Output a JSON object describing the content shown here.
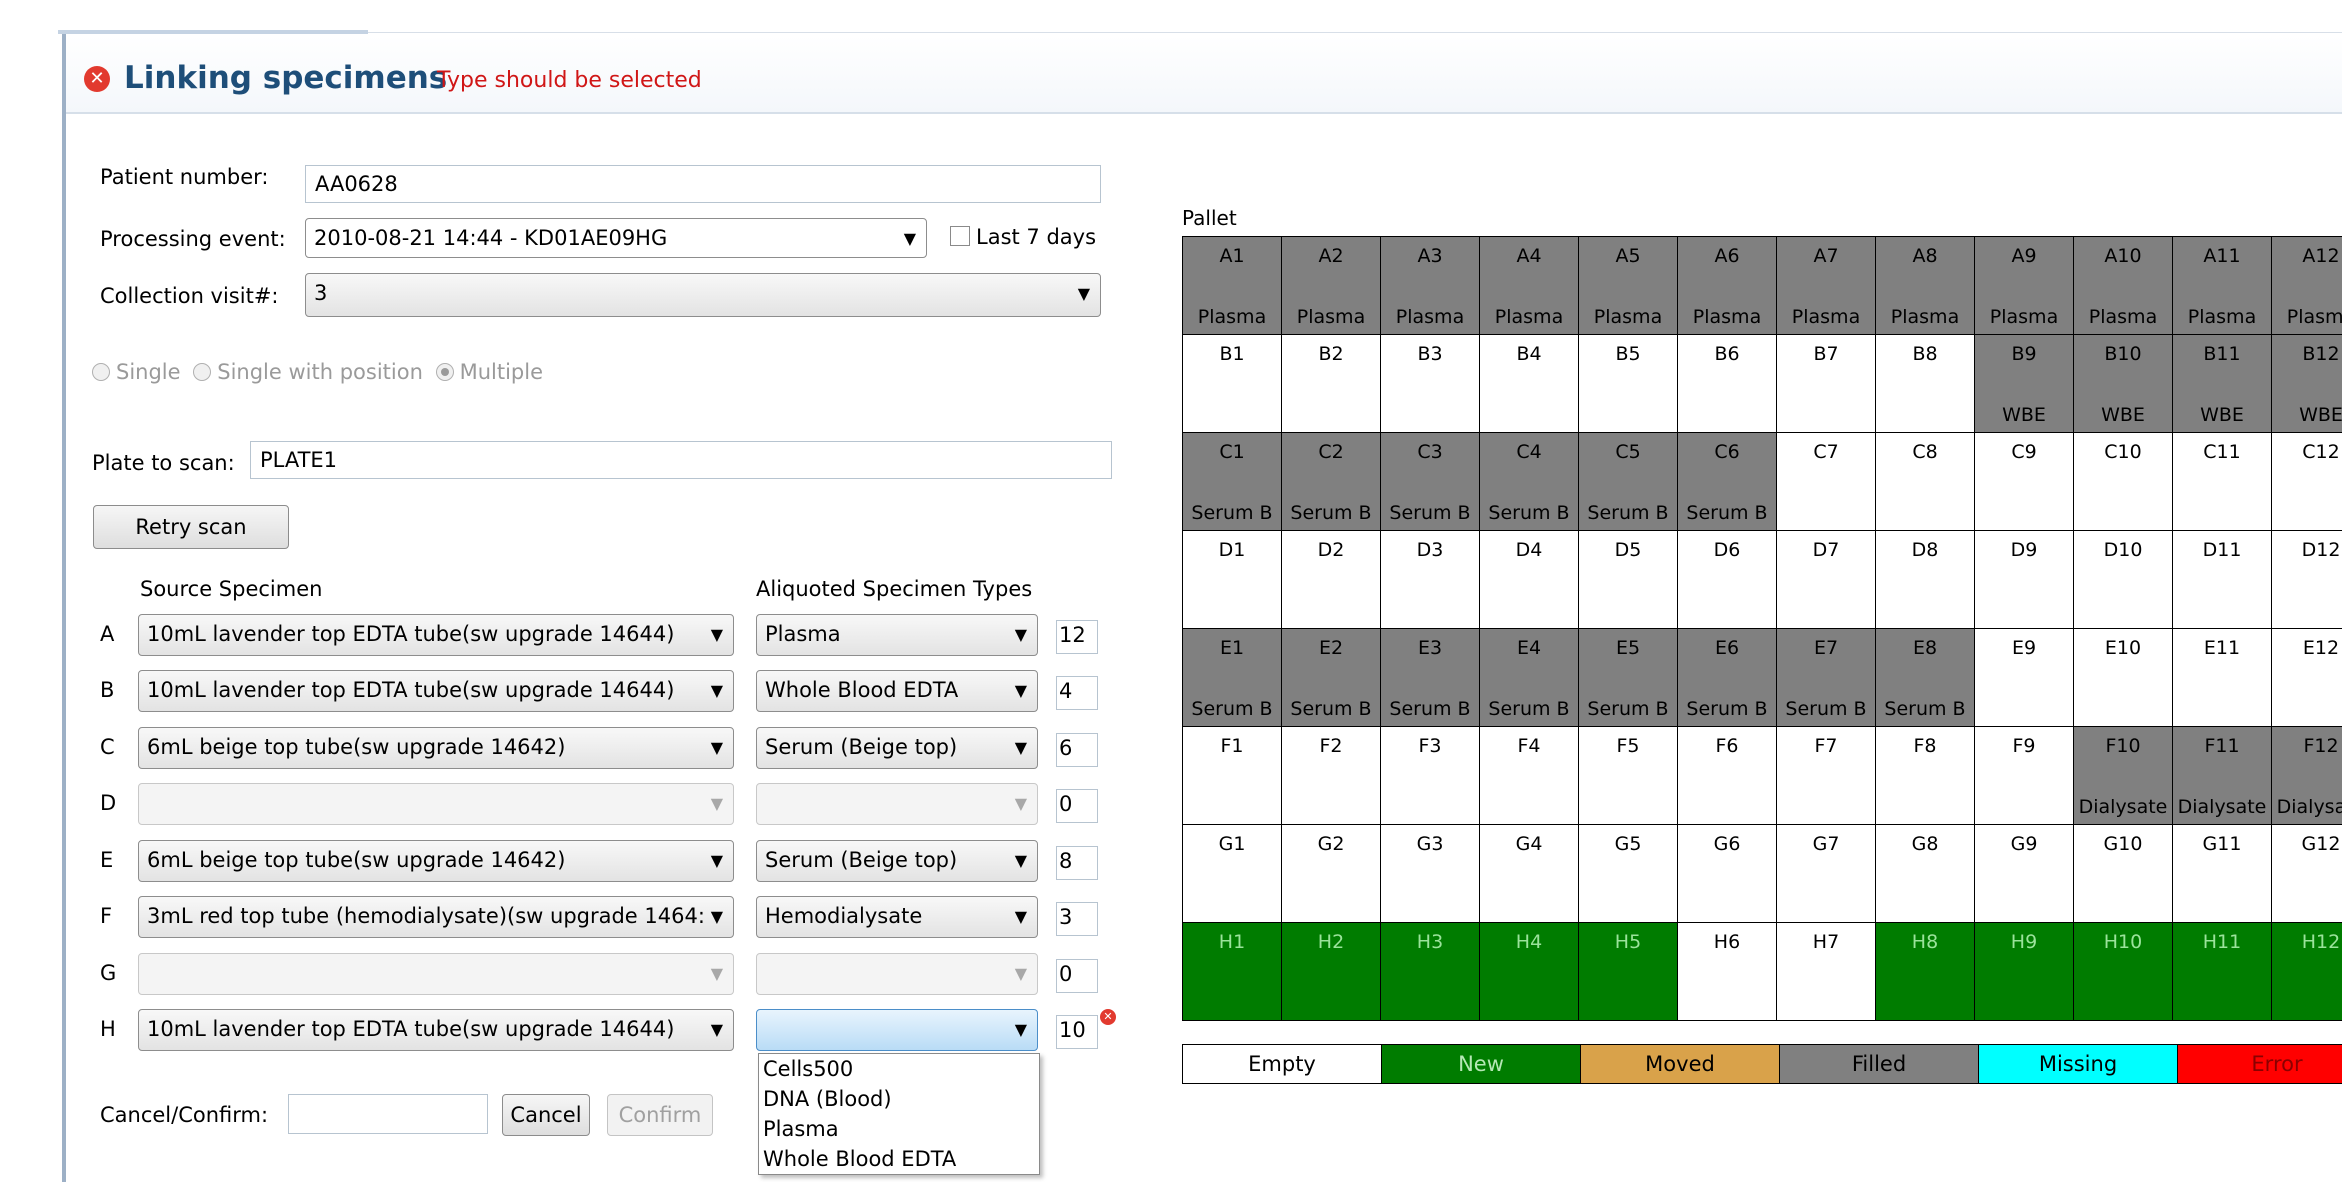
{
  "header": {
    "title": "Linking specimens",
    "error_message": "Type should be selected"
  },
  "form": {
    "patient_label": "Patient number:",
    "patient_value": "AA0628",
    "event_label": "Processing event:",
    "event_value": "2010-08-21 14:44 - KD01AE09HG",
    "last7_label": "Last 7 days",
    "visit_label": "Collection visit#:",
    "visit_value": "3",
    "mode_options": [
      "Single",
      "Single with position",
      "Multiple"
    ],
    "mode_selected": "Multiple",
    "plate_label": "Plate to scan:",
    "plate_value": "PLATE1",
    "retry_label": "Retry scan",
    "source_header": "Source Specimen",
    "types_header": "Aliquoted Specimen Types",
    "rows": [
      {
        "letter": "A",
        "source": "10mL lavender top EDTA tube(sw upgrade 14644)",
        "type": "Plasma",
        "qty": "12"
      },
      {
        "letter": "B",
        "source": "10mL lavender top EDTA tube(sw upgrade 14644)",
        "type": "Whole Blood EDTA",
        "qty": "4"
      },
      {
        "letter": "C",
        "source": "6mL beige top tube(sw upgrade 14642)",
        "type": "Serum (Beige top)",
        "qty": "6"
      },
      {
        "letter": "D",
        "source": "",
        "type": "",
        "qty": "0"
      },
      {
        "letter": "E",
        "source": "6mL beige top tube(sw upgrade 14642)",
        "type": "Serum (Beige top)",
        "qty": "8"
      },
      {
        "letter": "F",
        "source": "3mL red top tube (hemodialysate)(sw upgrade 1464:",
        "type": "Hemodialysate",
        "qty": "3"
      },
      {
        "letter": "G",
        "source": "",
        "type": "",
        "qty": "0"
      },
      {
        "letter": "H",
        "source": "10mL lavender top EDTA tube(sw upgrade 14644)",
        "type": "",
        "qty": "10"
      }
    ],
    "dropdown_options": [
      "Cells500",
      "DNA (Blood)",
      "Plasma",
      "Whole Blood EDTA"
    ],
    "confirm_label": "Cancel/Confirm:",
    "confirm_value": "",
    "cancel_button": "Cancel",
    "confirm_button": "Confirm"
  },
  "pallet": {
    "title": "Pallet",
    "colors": {
      "Filled": "#808080",
      "New": "#007c00",
      "Empty": "#ffffff"
    },
    "rows": [
      {
        "cells": [
          {
            "label": "A1",
            "type": "Plasma",
            "status": "Filled"
          },
          {
            "label": "A2",
            "type": "Plasma",
            "status": "Filled"
          },
          {
            "label": "A3",
            "type": "Plasma",
            "status": "Filled"
          },
          {
            "label": "A4",
            "type": "Plasma",
            "status": "Filled"
          },
          {
            "label": "A5",
            "type": "Plasma",
            "status": "Filled"
          },
          {
            "label": "A6",
            "type": "Plasma",
            "status": "Filled"
          },
          {
            "label": "A7",
            "type": "Plasma",
            "status": "Filled"
          },
          {
            "label": "A8",
            "type": "Plasma",
            "status": "Filled"
          },
          {
            "label": "A9",
            "type": "Plasma",
            "status": "Filled"
          },
          {
            "label": "A10",
            "type": "Plasma",
            "status": "Filled"
          },
          {
            "label": "A11",
            "type": "Plasma",
            "status": "Filled"
          },
          {
            "label": "A12",
            "type": "Plasma",
            "status": "Filled"
          }
        ]
      },
      {
        "cells": [
          {
            "label": "B1",
            "type": "",
            "status": "Empty"
          },
          {
            "label": "B2",
            "type": "",
            "status": "Empty"
          },
          {
            "label": "B3",
            "type": "",
            "status": "Empty"
          },
          {
            "label": "B4",
            "type": "",
            "status": "Empty"
          },
          {
            "label": "B5",
            "type": "",
            "status": "Empty"
          },
          {
            "label": "B6",
            "type": "",
            "status": "Empty"
          },
          {
            "label": "B7",
            "type": "",
            "status": "Empty"
          },
          {
            "label": "B8",
            "type": "",
            "status": "Empty"
          },
          {
            "label": "B9",
            "type": "WBE",
            "status": "Filled"
          },
          {
            "label": "B10",
            "type": "WBE",
            "status": "Filled"
          },
          {
            "label": "B11",
            "type": "WBE",
            "status": "Filled"
          },
          {
            "label": "B12",
            "type": "WBE",
            "status": "Filled"
          }
        ]
      },
      {
        "cells": [
          {
            "label": "C1",
            "type": "Serum B",
            "status": "Filled"
          },
          {
            "label": "C2",
            "type": "Serum B",
            "status": "Filled"
          },
          {
            "label": "C3",
            "type": "Serum B",
            "status": "Filled"
          },
          {
            "label": "C4",
            "type": "Serum B",
            "status": "Filled"
          },
          {
            "label": "C5",
            "type": "Serum B",
            "status": "Filled"
          },
          {
            "label": "C6",
            "type": "Serum B",
            "status": "Filled"
          },
          {
            "label": "C7",
            "type": "",
            "status": "Empty"
          },
          {
            "label": "C8",
            "type": "",
            "status": "Empty"
          },
          {
            "label": "C9",
            "type": "",
            "status": "Empty"
          },
          {
            "label": "C10",
            "type": "",
            "status": "Empty"
          },
          {
            "label": "C11",
            "type": "",
            "status": "Empty"
          },
          {
            "label": "C12",
            "type": "",
            "status": "Empty"
          }
        ]
      },
      {
        "cells": [
          {
            "label": "D1",
            "type": "",
            "status": "Empty"
          },
          {
            "label": "D2",
            "type": "",
            "status": "Empty"
          },
          {
            "label": "D3",
            "type": "",
            "status": "Empty"
          },
          {
            "label": "D4",
            "type": "",
            "status": "Empty"
          },
          {
            "label": "D5",
            "type": "",
            "status": "Empty"
          },
          {
            "label": "D6",
            "type": "",
            "status": "Empty"
          },
          {
            "label": "D7",
            "type": "",
            "status": "Empty"
          },
          {
            "label": "D8",
            "type": "",
            "status": "Empty"
          },
          {
            "label": "D9",
            "type": "",
            "status": "Empty"
          },
          {
            "label": "D10",
            "type": "",
            "status": "Empty"
          },
          {
            "label": "D11",
            "type": "",
            "status": "Empty"
          },
          {
            "label": "D12",
            "type": "",
            "status": "Empty"
          }
        ]
      },
      {
        "cells": [
          {
            "label": "E1",
            "type": "Serum B",
            "status": "Filled"
          },
          {
            "label": "E2",
            "type": "Serum B",
            "status": "Filled"
          },
          {
            "label": "E3",
            "type": "Serum B",
            "status": "Filled"
          },
          {
            "label": "E4",
            "type": "Serum B",
            "status": "Filled"
          },
          {
            "label": "E5",
            "type": "Serum B",
            "status": "Filled"
          },
          {
            "label": "E6",
            "type": "Serum B",
            "status": "Filled"
          },
          {
            "label": "E7",
            "type": "Serum B",
            "status": "Filled"
          },
          {
            "label": "E8",
            "type": "Serum B",
            "status": "Filled"
          },
          {
            "label": "E9",
            "type": "",
            "status": "Empty"
          },
          {
            "label": "E10",
            "type": "",
            "status": "Empty"
          },
          {
            "label": "E11",
            "type": "",
            "status": "Empty"
          },
          {
            "label": "E12",
            "type": "",
            "status": "Empty"
          }
        ]
      },
      {
        "cells": [
          {
            "label": "F1",
            "type": "",
            "status": "Empty"
          },
          {
            "label": "F2",
            "type": "",
            "status": "Empty"
          },
          {
            "label": "F3",
            "type": "",
            "status": "Empty"
          },
          {
            "label": "F4",
            "type": "",
            "status": "Empty"
          },
          {
            "label": "F5",
            "type": "",
            "status": "Empty"
          },
          {
            "label": "F6",
            "type": "",
            "status": "Empty"
          },
          {
            "label": "F7",
            "type": "",
            "status": "Empty"
          },
          {
            "label": "F8",
            "type": "",
            "status": "Empty"
          },
          {
            "label": "F9",
            "type": "",
            "status": "Empty"
          },
          {
            "label": "F10",
            "type": "Dialysate",
            "status": "Filled"
          },
          {
            "label": "F11",
            "type": "Dialysate",
            "status": "Filled"
          },
          {
            "label": "F12",
            "type": "Dialysate",
            "status": "Filled"
          }
        ]
      },
      {
        "cells": [
          {
            "label": "G1",
            "type": "",
            "status": "Empty"
          },
          {
            "label": "G2",
            "type": "",
            "status": "Empty"
          },
          {
            "label": "G3",
            "type": "",
            "status": "Empty"
          },
          {
            "label": "G4",
            "type": "",
            "status": "Empty"
          },
          {
            "label": "G5",
            "type": "",
            "status": "Empty"
          },
          {
            "label": "G6",
            "type": "",
            "status": "Empty"
          },
          {
            "label": "G7",
            "type": "",
            "status": "Empty"
          },
          {
            "label": "G8",
            "type": "",
            "status": "Empty"
          },
          {
            "label": "G9",
            "type": "",
            "status": "Empty"
          },
          {
            "label": "G10",
            "type": "",
            "status": "Empty"
          },
          {
            "label": "G11",
            "type": "",
            "status": "Empty"
          },
          {
            "label": "G12",
            "type": "",
            "status": "Empty"
          }
        ]
      },
      {
        "cells": [
          {
            "label": "H1",
            "type": "",
            "status": "New"
          },
          {
            "label": "H2",
            "type": "",
            "status": "New"
          },
          {
            "label": "H3",
            "type": "",
            "status": "New"
          },
          {
            "label": "H4",
            "type": "",
            "status": "New"
          },
          {
            "label": "H5",
            "type": "",
            "status": "New"
          },
          {
            "label": "H6",
            "type": "",
            "status": "Empty"
          },
          {
            "label": "H7",
            "type": "",
            "status": "Empty"
          },
          {
            "label": "H8",
            "type": "",
            "status": "New"
          },
          {
            "label": "H9",
            "type": "",
            "status": "New"
          },
          {
            "label": "H10",
            "type": "",
            "status": "New"
          },
          {
            "label": "H11",
            "type": "",
            "status": "New"
          },
          {
            "label": "H12",
            "type": "",
            "status": "New"
          }
        ]
      }
    ],
    "legend": [
      {
        "label": "Empty",
        "bg": "#ffffff",
        "fg": "#000000"
      },
      {
        "label": "New",
        "bg": "#007c00",
        "fg": "#b5e8b5"
      },
      {
        "label": "Moved",
        "bg": "#d9a24a",
        "fg": "#000000"
      },
      {
        "label": "Filled",
        "bg": "#808080",
        "fg": "#000000"
      },
      {
        "label": "Missing",
        "bg": "#00ffff",
        "fg": "#000000"
      },
      {
        "label": "Error",
        "bg": "#ff0000",
        "fg": "#8a0000"
      }
    ]
  }
}
